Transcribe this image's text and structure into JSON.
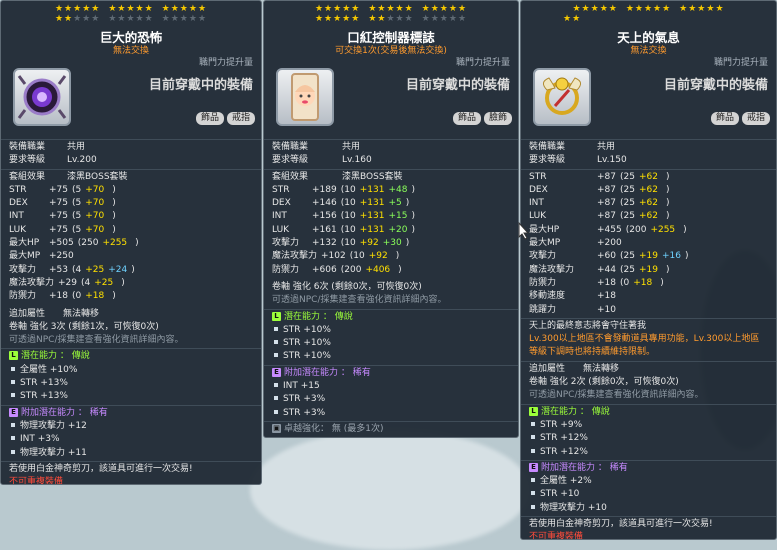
{
  "panels": [
    {
      "title": "巨大的恐怖",
      "subtitle": "無法交換",
      "job_up": "職門力提升量",
      "equipped": "目前穿戴中的裝備",
      "tags": [
        "飾品",
        "戒指"
      ],
      "job_label": "裝備職業",
      "job_value": "共用",
      "level_label": "要求等級",
      "level_value": "Lv.200",
      "set_label": "套組效果",
      "set_value": "漆黑BOSS套裝",
      "stats": [
        {
          "label": "STR",
          "total": "+75",
          "base": "(5",
          "b1": "+70",
          "b2": "",
          "close": ")"
        },
        {
          "label": "DEX",
          "total": "+75",
          "base": "(5",
          "b1": "+70",
          "b2": "",
          "close": ")"
        },
        {
          "label": "INT",
          "total": "+75",
          "base": "(5",
          "b1": "+70",
          "b2": "",
          "close": ")"
        },
        {
          "label": "LUK",
          "total": "+75",
          "base": "(5",
          "b1": "+70",
          "b2": "",
          "close": ")"
        },
        {
          "label": "最大HP",
          "total": "+505",
          "base": "(250",
          "b1": "+255",
          "b2": "",
          "close": ")"
        },
        {
          "label": "最大MP",
          "total": "+250",
          "base": "",
          "b1": "",
          "b2": "",
          "close": ""
        },
        {
          "label": "攻擊力",
          "total": "+53",
          "base": "(4",
          "b1": "+25",
          "b2": "+24",
          "close": ")"
        },
        {
          "label": "魔法攻擊力",
          "total": "+29",
          "base": "(4",
          "b1": "+25",
          "b2": "",
          "close": ")"
        },
        {
          "label": "防禦力",
          "total": "+18",
          "base": "(0",
          "b1": "+18",
          "b2": "",
          "close": ")"
        }
      ],
      "extra_label": "追加屬性",
      "extra_value": "無法轉移",
      "scroll": "卷軸 強化 3次 (剩餘1次，可恢復0次)",
      "npc": "可透過NPC/採集建查看強化資訊詳細內容。",
      "potential_header": "潛在能力 ： 傳說",
      "potential": [
        "全屬性 +10%",
        "STR +13%",
        "STR +13%"
      ],
      "additional_header": "附加潛在能力 ： 稀有",
      "additional": [
        "物理攻擊力 +12",
        "INT +3%",
        "物理攻擊力 +11"
      ],
      "scissors": "若使用白金神奇剪刀，該道具可進行一次交易!",
      "footer": "不可重複裝備"
    },
    {
      "title": "口紅控制器標誌",
      "subtitle": "可交換1次(交易後無法交換)",
      "job_up": "職門力提升量",
      "equipped": "目前穿戴中的裝備",
      "tags": [
        "飾品",
        "臉飾"
      ],
      "job_label": "裝備職業",
      "job_value": "共用",
      "level_label": "要求等級",
      "level_value": "Lv.160",
      "set_label": "套組效果",
      "set_value": "漆黑BOSS套裝",
      "stats": [
        {
          "label": "STR",
          "total": "+189",
          "base": "(10",
          "b1": "+131",
          "b2": "+48",
          "close": ")"
        },
        {
          "label": "DEX",
          "total": "+146",
          "base": "(10",
          "b1": "+131",
          "b2": "+5",
          "close": ")"
        },
        {
          "label": "INT",
          "total": "+156",
          "base": "(10",
          "b1": "+131",
          "b2": "+15",
          "close": ")"
        },
        {
          "label": "LUK",
          "total": "+161",
          "base": "(10",
          "b1": "+131",
          "b2": "+20",
          "close": ")"
        },
        {
          "label": "攻擊力",
          "total": "+132",
          "base": "(10",
          "b1": "+92",
          "b2": "+30",
          "close": ")"
        },
        {
          "label": "魔法攻擊力",
          "total": "+102",
          "base": "(10",
          "b1": "+92",
          "b2": "",
          "close": ")"
        },
        {
          "label": "防禦力",
          "total": "+606",
          "base": "(200",
          "b1": "+406",
          "b2": "",
          "close": ")"
        }
      ],
      "scroll": "卷軸 強化 6次 (剩餘0次，可恢復0次)",
      "npc": "可透過NPC/採集建查看強化資訊詳細內容。",
      "potential_header": "潛在能力 ： 傳說",
      "potential": [
        "STR +10%",
        "STR +10%",
        "STR +10%"
      ],
      "additional_header": "附加潛在能力 ： 稀有",
      "additional": [
        "INT +15",
        "STR +3%",
        "STR +3%"
      ],
      "transcend": "卓越強化： 無 (最多1次)"
    },
    {
      "title": "天上的氣息",
      "subtitle": "無法交換",
      "job_up": "職門力提升量",
      "equipped": "目前穿戴中的裝備",
      "tags": [
        "飾品",
        "戒指"
      ],
      "job_label": "裝備職業",
      "job_value": "共用",
      "level_label": "要求等級",
      "level_value": "Lv.150",
      "stats": [
        {
          "label": "STR",
          "total": "+87",
          "base": "(25",
          "b1": "+62",
          "b2": "",
          "close": ")"
        },
        {
          "label": "DEX",
          "total": "+87",
          "base": "(25",
          "b1": "+62",
          "b2": "",
          "close": ")"
        },
        {
          "label": "INT",
          "total": "+87",
          "base": "(25",
          "b1": "+62",
          "b2": "",
          "close": ")"
        },
        {
          "label": "LUK",
          "total": "+87",
          "base": "(25",
          "b1": "+62",
          "b2": "",
          "close": ")"
        },
        {
          "label": "最大HP",
          "total": "+455",
          "base": "(200",
          "b1": "+255",
          "b2": "",
          "close": ")"
        },
        {
          "label": "最大MP",
          "total": "+200",
          "base": "",
          "b1": "",
          "b2": "",
          "close": ""
        },
        {
          "label": "攻擊力",
          "total": "+60",
          "base": "(25",
          "b1": "+19",
          "b2": "+16",
          "close": ")"
        },
        {
          "label": "魔法攻擊力",
          "total": "+44",
          "base": "(25",
          "b1": "+19",
          "b2": "",
          "close": ")"
        },
        {
          "label": "防禦力",
          "total": "+18",
          "base": "(0",
          "b1": "+18",
          "b2": "",
          "close": ")"
        },
        {
          "label": "移動速度",
          "total": "+18",
          "base": "",
          "b1": "",
          "b2": "",
          "close": ""
        },
        {
          "label": "跳躍力",
          "total": "+10",
          "base": "",
          "b1": "",
          "b2": "",
          "close": ""
        }
      ],
      "desc": "天上的最終意志將會守住著我",
      "notice": "Lv.300以上地區不會發動道具專用功能，Lv.300以上地區等級下調時也將持續維持限制。",
      "extra_label": "追加屬性",
      "extra_value": "無法轉移",
      "scroll": "卷軸 強化 2次 (剩餘0次，可恢復0次)",
      "npc": "可透過NPC/採集建查看強化資訊詳細內容。",
      "potential_header": "潛在能力 ： 傳說",
      "potential": [
        "STR +9%",
        "STR +12%",
        "STR +12%"
      ],
      "additional_header": "附加潛在能力 ： 稀有",
      "additional": [
        "全屬性 +2%",
        "STR +10",
        "物理攻擊力 +10"
      ],
      "scissors": "若使用白金神奇剪刀，該道具可進行一次交易!",
      "footer": "不可重複裝備"
    }
  ],
  "colors": {
    "panel_bg": "#1c2630",
    "star_on": "#f5c800",
    "legendary": "#9cff3a",
    "rare": "#c78aff",
    "untradable": "#ff9b2e"
  },
  "icons": {
    "panel1": "purple-gem-ring-icon",
    "panel2": "lipstick-face-badge-icon",
    "panel3": "gold-winged-ring-icon"
  }
}
